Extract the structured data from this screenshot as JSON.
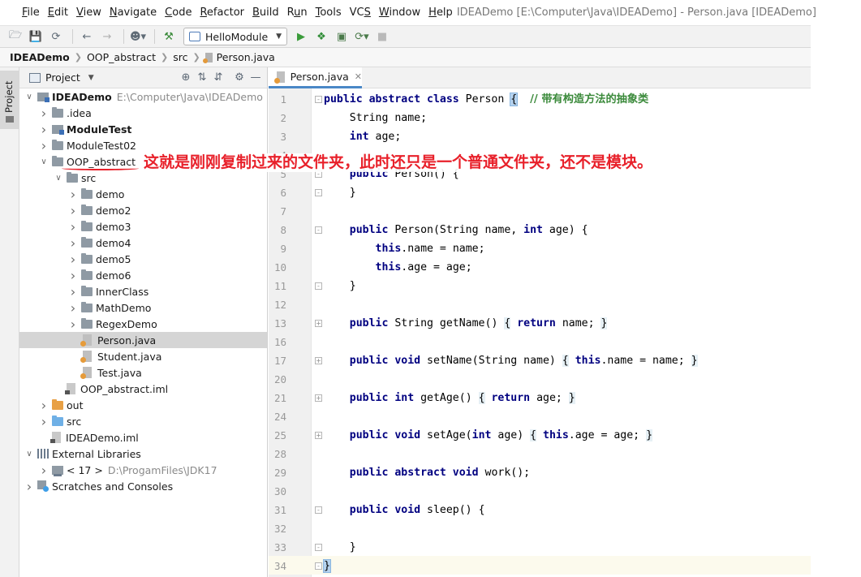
{
  "menubar": {
    "items": [
      {
        "label": "File",
        "mnemonic": "F",
        "rest": "ile"
      },
      {
        "label": "Edit",
        "mnemonic": "E",
        "rest": "dit"
      },
      {
        "label": "View",
        "mnemonic": "V",
        "rest": "iew"
      },
      {
        "label": "Navigate",
        "mnemonic": "N",
        "rest": "avigate"
      },
      {
        "label": "Code",
        "mnemonic": "C",
        "rest": "ode"
      },
      {
        "label": "Refactor",
        "mnemonic": "R",
        "rest": "efactor"
      },
      {
        "label": "Build",
        "mnemonic": "B",
        "rest": "uild"
      },
      {
        "label": "Run",
        "mnemonic": "u",
        "rest": "n",
        "prefix": "R"
      },
      {
        "label": "Tools",
        "mnemonic": "T",
        "rest": "ools"
      },
      {
        "label": "VCS",
        "mnemonic": "S",
        "rest": "",
        "prefix": "VC"
      },
      {
        "label": "Window",
        "mnemonic": "W",
        "rest": "indow"
      },
      {
        "label": "Help",
        "mnemonic": "H",
        "rest": "elp"
      }
    ],
    "window_title": "IDEADemo [E:\\Computer\\Java\\IDEADemo] - Person.java [IDEADemo]"
  },
  "toolbar": {
    "run_config": "HelloModule"
  },
  "breadcrumb": [
    "IDEADemo",
    "OOP_abstract",
    "src",
    "Person.java"
  ],
  "side_strip": {
    "label": "Project"
  },
  "project_panel": {
    "title": "Project",
    "tree": [
      {
        "level": 0,
        "arrow": "down",
        "icon": "module",
        "label": "IDEADemo",
        "bold": true,
        "path": "E:\\Computer\\Java\\IDEADemo"
      },
      {
        "level": 1,
        "arrow": "right",
        "icon": "folder",
        "label": ".idea"
      },
      {
        "level": 1,
        "arrow": "right",
        "icon": "module",
        "label": "ModuleTest",
        "bold": true
      },
      {
        "level": 1,
        "arrow": "right",
        "icon": "folder",
        "label": "ModuleTest02"
      },
      {
        "level": 1,
        "arrow": "down",
        "icon": "folder",
        "label": "OOP_abstract",
        "underline": true
      },
      {
        "level": 2,
        "arrow": "down",
        "icon": "folder",
        "label": "src"
      },
      {
        "level": 3,
        "arrow": "right",
        "icon": "folder",
        "label": "demo"
      },
      {
        "level": 3,
        "arrow": "right",
        "icon": "folder",
        "label": "demo2"
      },
      {
        "level": 3,
        "arrow": "right",
        "icon": "folder",
        "label": "demo3"
      },
      {
        "level": 3,
        "arrow": "right",
        "icon": "folder",
        "label": "demo4"
      },
      {
        "level": 3,
        "arrow": "right",
        "icon": "folder",
        "label": "demo5"
      },
      {
        "level": 3,
        "arrow": "right",
        "icon": "folder",
        "label": "demo6"
      },
      {
        "level": 3,
        "arrow": "right",
        "icon": "folder",
        "label": "InnerClass"
      },
      {
        "level": 3,
        "arrow": "right",
        "icon": "folder",
        "label": "MathDemo"
      },
      {
        "level": 3,
        "arrow": "right",
        "icon": "folder",
        "label": "RegexDemo"
      },
      {
        "level": 3,
        "arrow": "none",
        "icon": "java",
        "label": "Person.java",
        "selected": true
      },
      {
        "level": 3,
        "arrow": "none",
        "icon": "java",
        "label": "Student.java"
      },
      {
        "level": 3,
        "arrow": "none",
        "icon": "java",
        "label": "Test.java"
      },
      {
        "level": 2,
        "arrow": "none",
        "icon": "iml",
        "label": "OOP_abstract.iml"
      },
      {
        "level": 1,
        "arrow": "right",
        "icon": "folder-orange",
        "label": "out"
      },
      {
        "level": 1,
        "arrow": "right",
        "icon": "folder-blue",
        "label": "src"
      },
      {
        "level": 1,
        "arrow": "none",
        "icon": "iml",
        "label": "IDEADemo.iml"
      },
      {
        "level": 0,
        "arrow": "down",
        "icon": "library",
        "label": "External Libraries"
      },
      {
        "level": 1,
        "arrow": "right",
        "icon": "jdk",
        "label": "< 17 >",
        "path": "D:\\ProgamFiles\\JDK17"
      },
      {
        "level": 0,
        "arrow": "right",
        "icon": "scratch",
        "label": "Scratches and Consoles"
      }
    ]
  },
  "editor": {
    "tab_label": "Person.java",
    "lines": [
      {
        "n": "1",
        "fold": "-",
        "html": "<span class=\"kw\">public abstract class</span> Person <span class=\"bracehl\">{</span>  <span class=\"cm\">// 带有构造方法的抽象类</span>"
      },
      {
        "n": "2",
        "html": "    String name;"
      },
      {
        "n": "3",
        "html": "    <span class=\"kw\">int</span> age;"
      },
      {
        "n": "4",
        "html": ""
      },
      {
        "n": "5",
        "fold": "-",
        "html": "    <span class=\"kw\">public</span> Person() {"
      },
      {
        "n": "6",
        "fold": "-",
        "html": "    }"
      },
      {
        "n": "7",
        "html": ""
      },
      {
        "n": "8",
        "fold": "-",
        "html": "    <span class=\"kw\">public</span> Person(String name, <span class=\"kw\">int</span> age) {"
      },
      {
        "n": "9",
        "html": "        <span class=\"kw\">this</span>.name = name;"
      },
      {
        "n": "10",
        "html": "        <span class=\"kw\">this</span>.age = age;"
      },
      {
        "n": "11",
        "fold": "-",
        "html": "    }"
      },
      {
        "n": "12",
        "html": ""
      },
      {
        "n": "13",
        "fold": "+",
        "html": "    <span class=\"kw\">public</span> String getName() <span class=\"brace\">{</span> <span class=\"kw\">return</span> name; <span class=\"brace\">}</span>"
      },
      {
        "n": "16",
        "html": ""
      },
      {
        "n": "17",
        "fold": "+",
        "html": "    <span class=\"kw\">public void</span> setName(String name) <span class=\"brace\">{</span> <span class=\"kw\">this</span>.name = name; <span class=\"brace\">}</span>"
      },
      {
        "n": "20",
        "html": ""
      },
      {
        "n": "21",
        "fold": "+",
        "html": "    <span class=\"kw\">public int</span> getAge() <span class=\"brace\">{</span> <span class=\"kw\">return</span> age; <span class=\"brace\">}</span>"
      },
      {
        "n": "24",
        "html": ""
      },
      {
        "n": "25",
        "fold": "+",
        "html": "    <span class=\"kw\">public void</span> setAge(<span class=\"kw\">int</span> age) <span class=\"brace\">{</span> <span class=\"kw\">this</span>.age = age; <span class=\"brace\">}</span>"
      },
      {
        "n": "28",
        "html": ""
      },
      {
        "n": "29",
        "html": "    <span class=\"kw\">public abstract void</span> work();"
      },
      {
        "n": "30",
        "html": ""
      },
      {
        "n": "31",
        "fold": "-",
        "html": "    <span class=\"kw\">public void</span> sleep() {"
      },
      {
        "n": "32",
        "html": ""
      },
      {
        "n": "33",
        "fold": "-",
        "html": "    }"
      },
      {
        "n": "34",
        "fold": "-",
        "html": "<span class=\"bracehl\">}</span>"
      }
    ]
  },
  "annotation": {
    "text": "这就是刚刚复制过来的文件夹，此时还只是一个普通文件夹，还不是模块。"
  }
}
